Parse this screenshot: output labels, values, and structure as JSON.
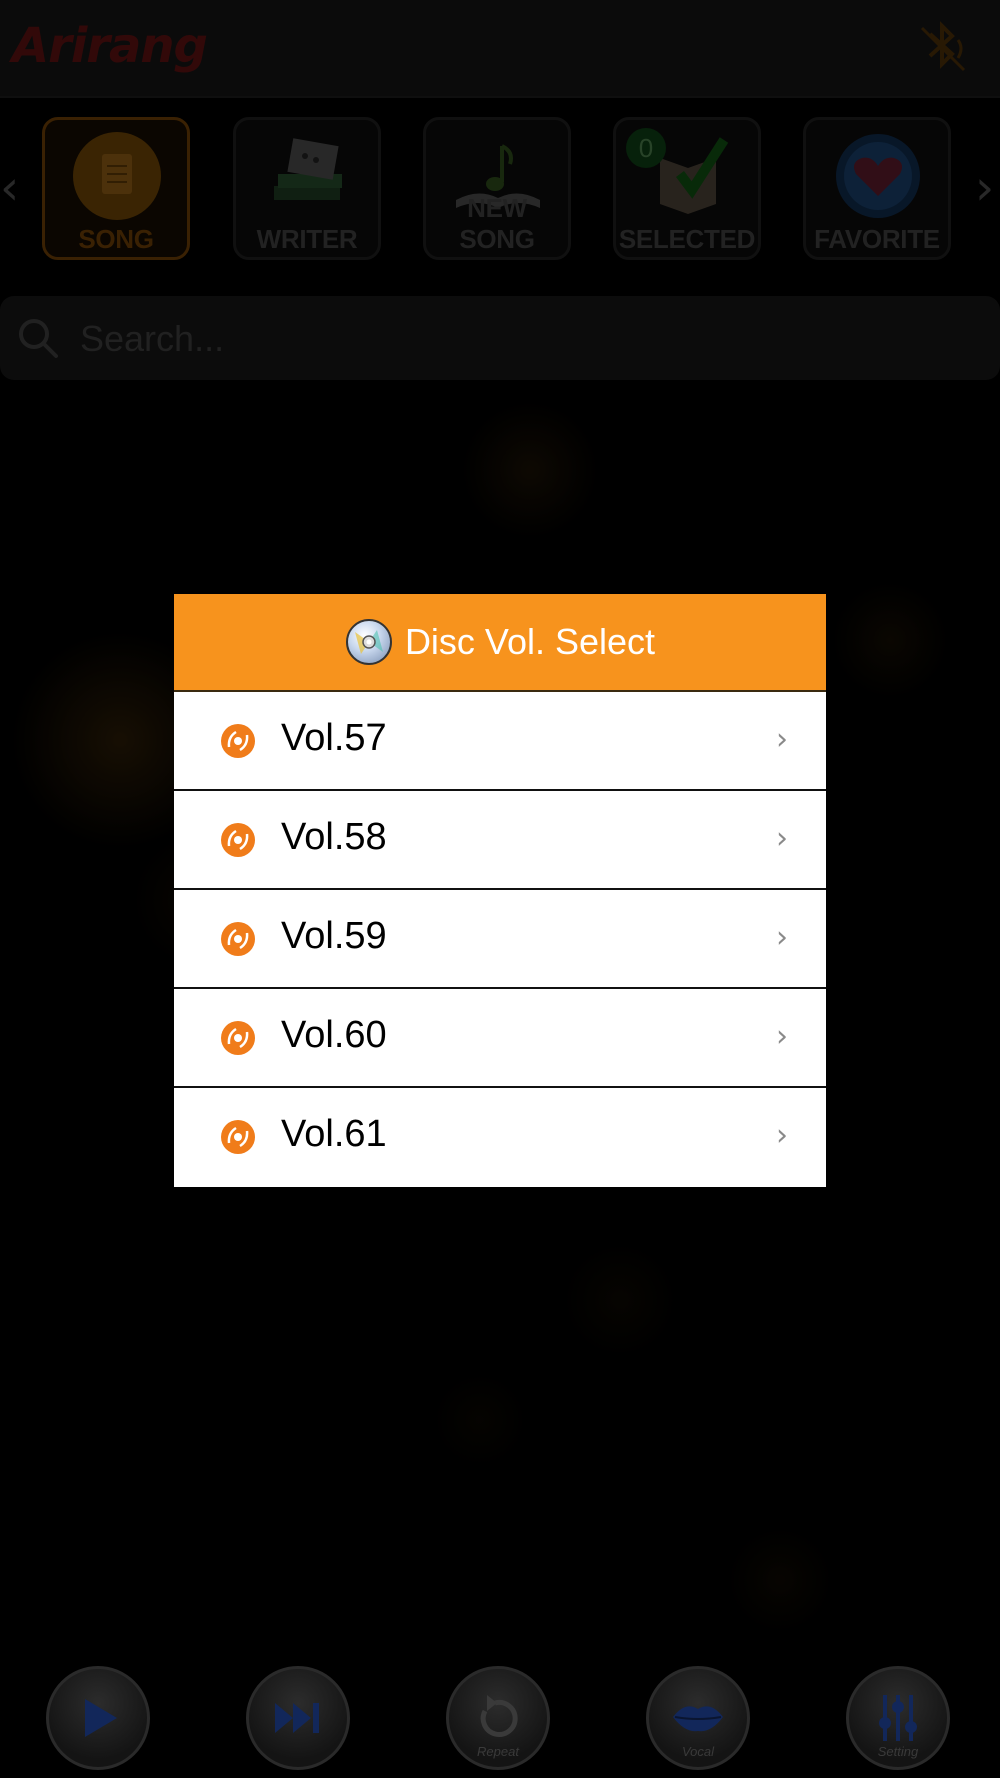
{
  "header": {
    "logo_text": "Arirang",
    "bluetooth_icon": "bluetooth-off-icon"
  },
  "tabs": [
    {
      "label": "SONG",
      "icon": "document-icon",
      "active": true
    },
    {
      "label": "WRITER",
      "icon": "sheet-music-books-icon"
    },
    {
      "label": "NEW SONG",
      "icon": "open-book-note-icon"
    },
    {
      "label": "SELECTED",
      "icon": "book-check-icon",
      "badge": "0"
    },
    {
      "label": "FAVORITE",
      "icon": "heart-icon"
    }
  ],
  "search": {
    "placeholder": "Search..."
  },
  "modal": {
    "title": "Disc Vol. Select",
    "items": [
      {
        "label": "Vol.57"
      },
      {
        "label": "Vol.58"
      },
      {
        "label": "Vol.59"
      },
      {
        "label": "Vol.60"
      },
      {
        "label": "Vol.61"
      }
    ]
  },
  "controls": {
    "play": "",
    "next": "",
    "repeat_label": "Repeat",
    "vocal_label": "Vocal",
    "setting_label": "Setting"
  },
  "colors": {
    "accent": "#f7931d",
    "disc_icon": "#f07c1a"
  }
}
